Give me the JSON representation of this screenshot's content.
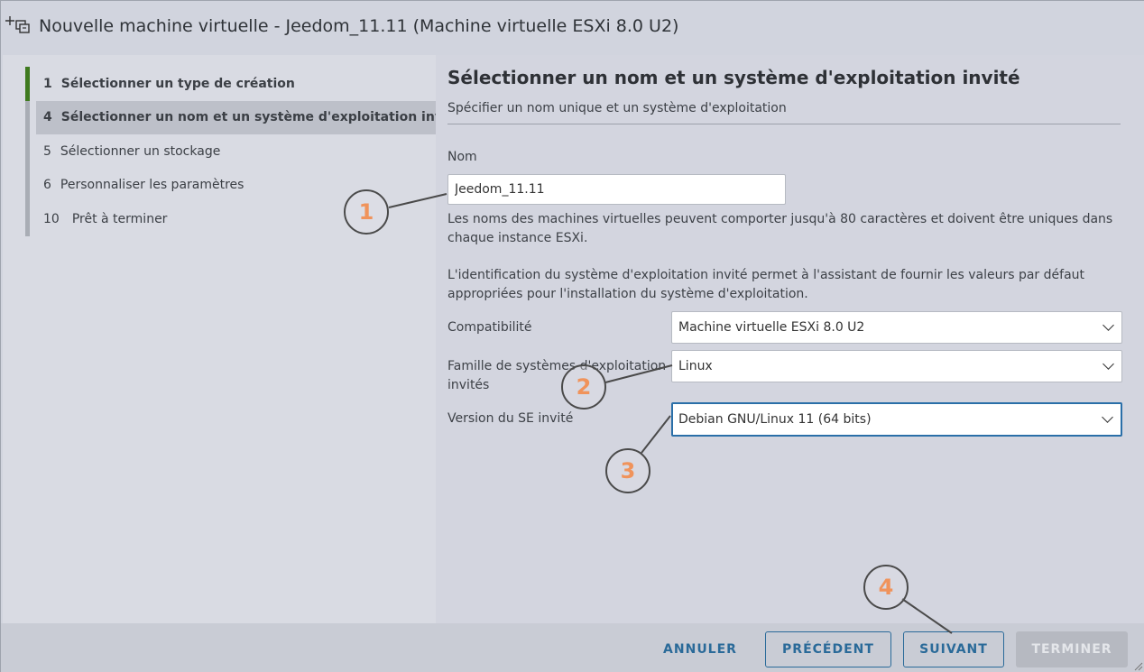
{
  "window": {
    "title": "Nouvelle machine virtuelle - Jeedom_11.11 (Machine virtuelle ESXi 8.0 U2)"
  },
  "steps": [
    {
      "num": "1",
      "label": "Sélectionner un type de création"
    },
    {
      "num": "4",
      "label": "Sélectionner un nom et un système d'exploitation invité"
    },
    {
      "num": "5",
      "label": "Sélectionner un stockage"
    },
    {
      "num": "6",
      "label": "Personnaliser les paramètres"
    },
    {
      "num": "10",
      "label": "Prêt à terminer"
    }
  ],
  "page": {
    "heading": "Sélectionner un nom et un système d'exploitation invité",
    "subheading": "Spécifier un nom unique et un système d'exploitation"
  },
  "form": {
    "name_label": "Nom",
    "name_value": "Jeedom_11.11",
    "name_help": "Les noms des machines virtuelles peuvent comporter jusqu'à 80 caractères et doivent être uniques dans chaque instance ESXi.",
    "os_help": "L'identification du système d'exploitation invité permet à l'assistant de fournir les valeurs par défaut appropriées pour l'installation du système d'exploitation.",
    "compat_label": "Compatibilité",
    "compat_value": "Machine virtuelle ESXi 8.0 U2",
    "family_label_1": "Famille de systèmes d'exploitation",
    "family_label_2": "invités",
    "family_value": "Linux",
    "version_label": "Version du SE invité",
    "version_value": "Debian GNU/Linux 11 (64 bits)"
  },
  "footer": {
    "cancel": "ANNULER",
    "previous": "PRÉCÉDENT",
    "next": "SUIVANT",
    "finish": "TERMINER"
  },
  "callouts": [
    "1",
    "2",
    "3",
    "4"
  ],
  "colors": {
    "accent": "#2a6a99",
    "completed_step": "#3f7a1f",
    "callout_number": "#f0935b"
  }
}
